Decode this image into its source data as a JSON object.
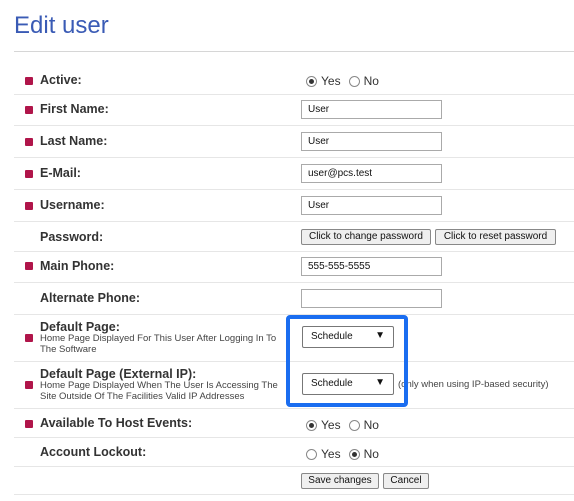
{
  "page": {
    "title": "Edit user"
  },
  "colors": {
    "title": "#3a5bb5",
    "required_bullet": "#b0154a",
    "highlight_box": "#1a6df0"
  },
  "fields": {
    "active": {
      "label": "Active:",
      "required": true,
      "options": [
        "Yes",
        "No"
      ],
      "selected": "Yes"
    },
    "first_name": {
      "label": "First Name:",
      "required": true,
      "value": "User"
    },
    "last_name": {
      "label": "Last Name:",
      "required": true,
      "value": "User"
    },
    "email": {
      "label": "E-Mail:",
      "required": true,
      "value": "user@pcs.test"
    },
    "username": {
      "label": "Username:",
      "required": true,
      "value": "User"
    },
    "password": {
      "label": "Password:",
      "required": false,
      "change_button": "Click to change password",
      "reset_button": "Click to reset password"
    },
    "main_phone": {
      "label": "Main Phone:",
      "required": true,
      "value": "555-555-5555"
    },
    "alternate_phone": {
      "label": "Alternate Phone:",
      "required": false,
      "value": ""
    },
    "default_page": {
      "label": "Default Page:",
      "description": "Home Page Displayed For This User After Logging In To The Software",
      "selected": "Schedule",
      "arrow": "▼"
    },
    "default_page_external": {
      "label": "Default Page (External IP):",
      "description": "Home Page Displayed When The User Is Accessing The Site Outside Of The Facilities Valid IP Addresses",
      "selected": "Schedule",
      "arrow": "▼",
      "note": "(only when using IP-based security)"
    },
    "host_events": {
      "label": "Available To Host Events:",
      "required": true,
      "options": [
        "Yes",
        "No"
      ],
      "selected": "Yes"
    },
    "account_lockout": {
      "label": "Account Lockout:",
      "required": false,
      "options": [
        "Yes",
        "No"
      ],
      "selected": "No"
    }
  },
  "actions": {
    "save": "Save changes",
    "cancel": "Cancel"
  }
}
